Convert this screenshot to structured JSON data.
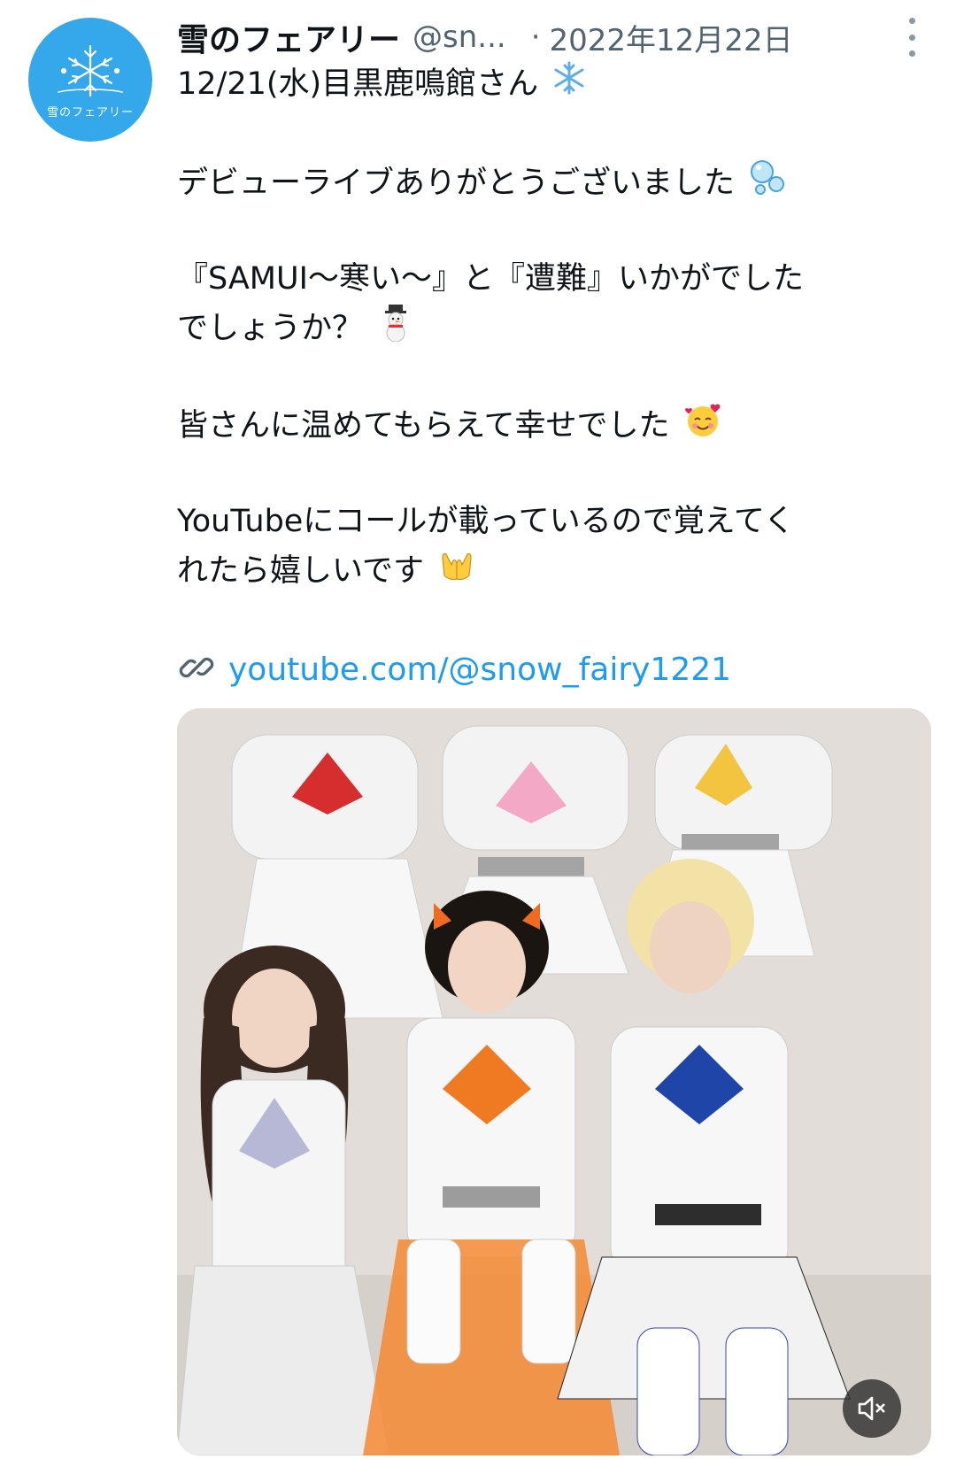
{
  "tweet": {
    "avatar_text": "雪のフェアリー",
    "display_name": "雪のフェアリー",
    "handle": "@sn...",
    "separator": "·",
    "date": "2022年12月22日",
    "lines": [
      "12/21(水)目黒鹿鳴館さん",
      "デビューライブありがとうございました",
      "『SAMUI〜寒い〜』と『遭難』いかがでした",
      "でしょうか？",
      "皆さんに温めてもらえて幸せでした",
      "YouTubeにコールが載っているので覚えてく",
      "れたら嬉しいです"
    ],
    "link": "youtube.com/@snow_fairy1221"
  },
  "colors": {
    "avatar_bg": "#35a8ec",
    "link": "#1d9bf0",
    "secondary_text": "#536471"
  },
  "icons": [
    "more-options-icon",
    "snowflake-emoji",
    "bubbles-emoji",
    "snowman-emoji",
    "smiling-hearts-emoji",
    "palms-up-emoji",
    "link-icon",
    "muted-speaker-icon"
  ]
}
